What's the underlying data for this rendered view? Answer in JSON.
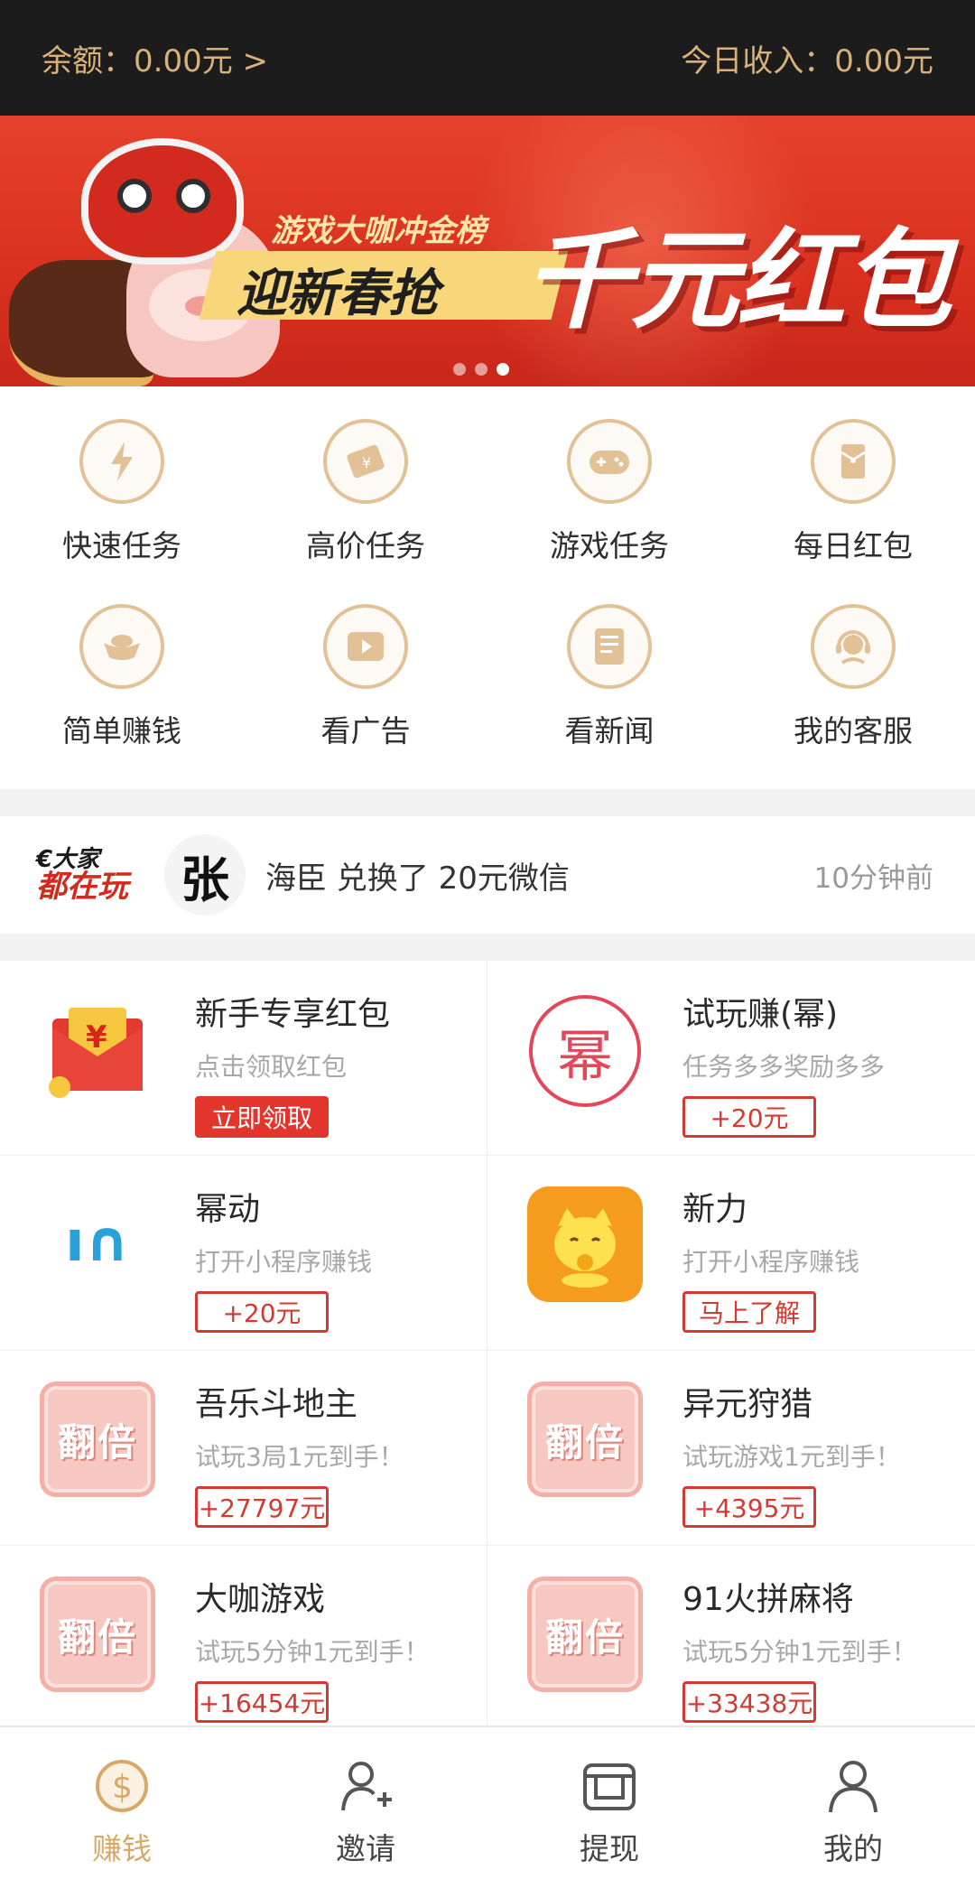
{
  "header": {
    "balance": "余额：0.00元 >",
    "today_income": "今日收入：0.00元"
  },
  "banner": {
    "subtitle": "游戏大咖冲金榜",
    "tagline": "迎新春抢",
    "headline": "千元红包",
    "slide_index": 3,
    "slide_count": 3
  },
  "menu": [
    {
      "label": "快速任务",
      "icon": "lightning-icon"
    },
    {
      "label": "高价任务",
      "icon": "ticket-icon"
    },
    {
      "label": "游戏任务",
      "icon": "gamepad-icon"
    },
    {
      "label": "每日红包",
      "icon": "red-envelope-icon"
    },
    {
      "label": "简单赚钱",
      "icon": "gold-ingot-icon"
    },
    {
      "label": "看广告",
      "icon": "play-video-icon"
    },
    {
      "label": "看新闻",
      "icon": "news-icon"
    },
    {
      "label": "我的客服",
      "icon": "customer-service-icon"
    }
  ],
  "ticker": {
    "logo_line1": "€大家",
    "logo_line2": "都在玩",
    "avatar_char": "张",
    "message": "海臣 兑换了 20元微信",
    "time": "10分钟前"
  },
  "tasks": [
    {
      "title": "新手专享红包",
      "desc": "点击领取红包",
      "tag": "立即领取"
    },
    {
      "title": "试玩赚(幂)",
      "desc": "任务多多奖励多多",
      "tag": "+20元",
      "icon_char": "幂"
    },
    {
      "title": "幂动",
      "desc": "打开小程序赚钱",
      "tag": "+20元",
      "icon_text": "ı∩"
    },
    {
      "title": "新力",
      "desc": "打开小程序赚钱",
      "tag": "马上了解"
    },
    {
      "title": "吾乐斗地主",
      "desc": "试玩3局1元到手！",
      "tag": "+27797元",
      "icon_text": "翻倍"
    },
    {
      "title": "异元狩猎",
      "desc": "试玩游戏1元到手！",
      "tag": "+4395元",
      "icon_text": "翻倍"
    },
    {
      "title": "大咖游戏",
      "desc": "试玩5分钟1元到手！",
      "tag": "+16454元",
      "icon_text": "翻倍"
    },
    {
      "title": "91火拼麻将",
      "desc": "试玩5分钟1元到手！",
      "tag": "+33438元",
      "icon_text": "翻倍"
    }
  ],
  "tabs": [
    {
      "label": "赚钱",
      "active": true
    },
    {
      "label": "邀请",
      "active": false
    },
    {
      "label": "提现",
      "active": false
    },
    {
      "label": "我的",
      "active": false
    }
  ],
  "colors": {
    "accent_gold": "#d8a868",
    "red": "#e2362d",
    "top_bar": "#1c1c1c"
  }
}
